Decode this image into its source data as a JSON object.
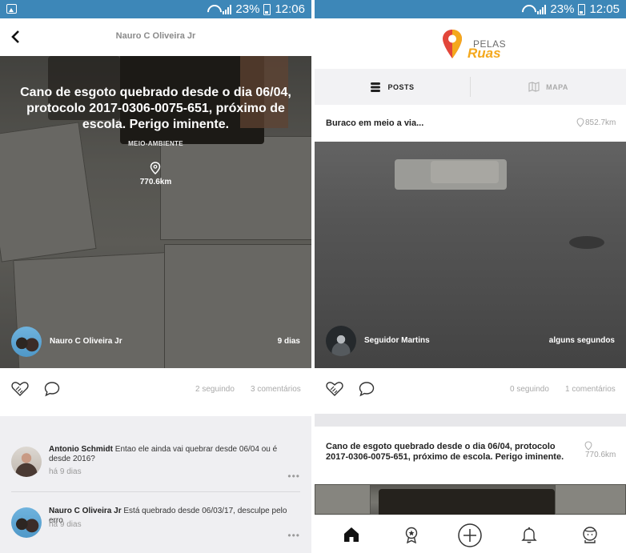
{
  "status_left": {
    "battery": "23%",
    "time": "12:06"
  },
  "status_right": {
    "battery": "23%",
    "time": "12:05"
  },
  "detail": {
    "header_title": "Nauro C Oliveira Jr",
    "title": "Cano de esgoto quebrado desde o dia 06/04, protocolo 2017-0306-0075-651, próximo de escola. Perigo iminente.",
    "category": "MEIO-AMBIENTE",
    "distance": "770.6km",
    "author": "Nauro C Oliveira Jr",
    "age": "9 dias",
    "following": "2 seguindo",
    "comments_count": "3 comentários"
  },
  "comments": [
    {
      "author": "Antonio Schmidt",
      "text": "Entao ele ainda vai quebrar desde 06/04 ou é desde 2016?",
      "time": "há 9 dias",
      "more": "•••"
    },
    {
      "author": "Nauro C Oliveira Jr",
      "text": "Está quebrado desde 06/03/17, desculpe pelo erro",
      "time": "há 9 dias",
      "more": "•••"
    }
  ],
  "app": {
    "logo_top": "PELAS",
    "logo_bottom": "Ruas"
  },
  "tabs": {
    "posts": "POSTS",
    "map": "MAPA"
  },
  "feed": [
    {
      "title": "Buraco em meio a via...",
      "distance": "852.7km",
      "author": "Seguidor Martins",
      "age": "alguns segundos",
      "following": "0 seguindo",
      "comments": "1 comentários"
    },
    {
      "title": "Cano de esgoto quebrado desde o dia 06/04, protocolo 2017-0306-0075-651, próximo de escola. Perigo iminente.",
      "distance": "770.6km"
    }
  ],
  "colors": {
    "status_bar": "#3d87b8",
    "logo_accent": "#f4a81d",
    "logo_pin": "#e2463a"
  },
  "icons": [
    "back-arrow-icon",
    "location-pin-icon",
    "handshake-icon",
    "comment-icon",
    "list-icon",
    "map-icon",
    "home-icon",
    "badge-icon",
    "add-circle-icon",
    "bell-icon",
    "profile-icon"
  ]
}
